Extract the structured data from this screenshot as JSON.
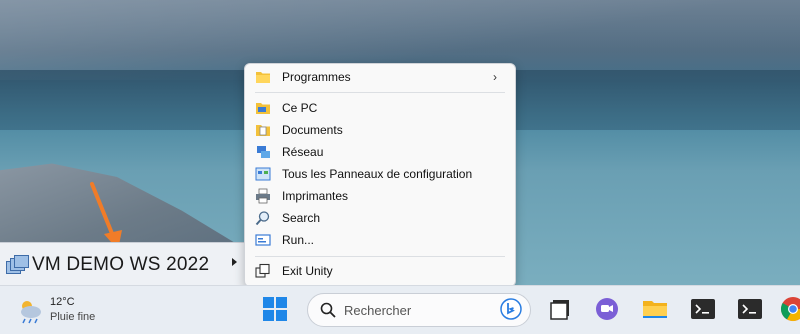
{
  "taskbar_item": {
    "label": "VM DEMO WS 2022",
    "icon": "vm-windows-icon"
  },
  "context_menu": {
    "items": [
      {
        "label": "Programmes",
        "icon": "folder-icon",
        "has_submenu": true
      },
      {
        "label": "Ce PC",
        "icon": "pc-folder-icon"
      },
      {
        "label": "Documents",
        "icon": "documents-icon"
      },
      {
        "label": "Réseau",
        "icon": "network-icon"
      },
      {
        "label": "Tous les Panneaux de configuration",
        "icon": "control-panel-icon"
      },
      {
        "label": "Imprimantes",
        "icon": "printer-icon"
      },
      {
        "label": "Search",
        "icon": "search-icon"
      },
      {
        "label": "Run...",
        "icon": "run-icon"
      },
      {
        "label": "Exit Unity",
        "icon": "exit-unity-icon"
      }
    ]
  },
  "weather": {
    "temperature": "12°C",
    "description": "Pluie fine"
  },
  "search": {
    "placeholder": "Rechercher"
  },
  "colors": {
    "accent": "#0067c0",
    "arrow": "#f07c28"
  }
}
